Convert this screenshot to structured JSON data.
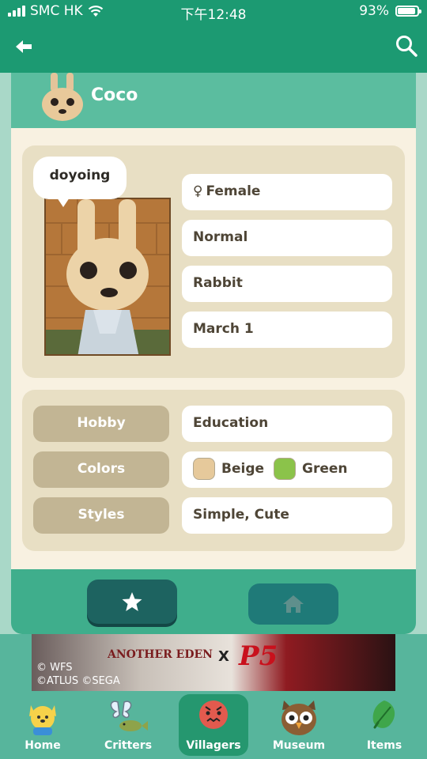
{
  "status_bar": {
    "carrier": "SMC HK",
    "time": "下午12:48",
    "battery": "93%",
    "battery_level": 0.93
  },
  "header": {
    "back_icon": "back-arrow-icon",
    "search_icon": "search-icon"
  },
  "villager": {
    "name": "Coco",
    "catchphrase": "doyoing",
    "gender_symbol": "♀",
    "gender": "Female",
    "personality": "Normal",
    "species": "Rabbit",
    "birthday": "March 1"
  },
  "details": {
    "hobby_label": "Hobby",
    "hobby": "Education",
    "colors_label": "Colors",
    "colors": [
      {
        "name": "Beige",
        "hex": "#e6c99b"
      },
      {
        "name": "Green",
        "hex": "#8bc34a"
      }
    ],
    "styles_label": "Styles",
    "styles": "Simple, Cute"
  },
  "actions": {
    "favorite_icon": "star-icon",
    "home_icon": "house-icon"
  },
  "ad": {
    "brand": "ANOTHER EDEN",
    "cross": "X",
    "partner": "P5",
    "copyright_line1": "© WFS",
    "copyright_line2": "©ATLUS ©SEGA"
  },
  "tabs": [
    {
      "label": "Home",
      "icon": "isabelle-icon",
      "active": false
    },
    {
      "label": "Critters",
      "icon": "butterfly-fish-icon",
      "active": false
    },
    {
      "label": "Villagers",
      "icon": "villager-icon",
      "active": true
    },
    {
      "label": "Museum",
      "icon": "owl-icon",
      "active": false
    },
    {
      "label": "Items",
      "icon": "leaf-icon",
      "active": false
    }
  ],
  "colors": {
    "header": "#1c9a72",
    "accent": "#1d6360",
    "panel": "#e8dfc4",
    "label_pill": "#c2b594"
  }
}
